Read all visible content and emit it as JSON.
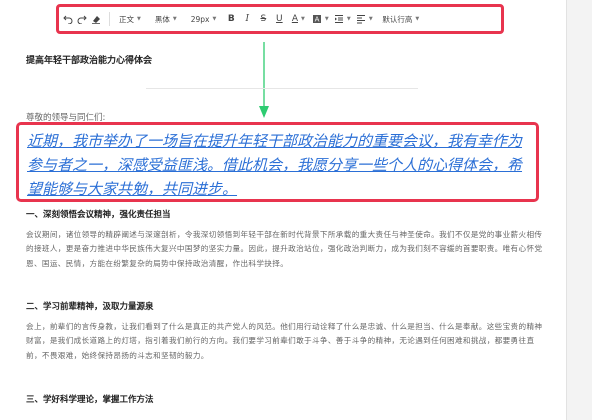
{
  "toolbar": {
    "undo": "undo",
    "redo": "redo",
    "format_painter": "format-painter",
    "paragraph_style": "正文",
    "font_family": "黑体",
    "font_size": "29px",
    "bold": "B",
    "italic": "I",
    "strike": "S",
    "underline": "U",
    "font_color": "A",
    "line_spacing": "默认行高"
  },
  "document": {
    "title": "提高年轻干部政治能力心得体会",
    "greeting": "尊敬的领导与同仁们:",
    "highlighted_paragraph": "近期，我市举办了一场旨在提升年轻干部政治能力的重要会议，我有幸作为参与者之一，深感受益匪浅。借此机会，我愿分享一些个人的心得体会，希望能够与大家共勉，共同进步。",
    "sections": [
      {
        "heading": "一、深刻领悟会议精神，强化责任担当",
        "body": "会议期间，诸位领导的精辟阐述与深邃剖析，令我深切领悟到年轻干部在新时代背景下所承载的重大责任与神圣使命。我们不仅是党的事业薪火相传的接班人，更是奋力推进中华民族伟大复兴中国梦的坚实力量。因此，提升政治站位，强化政治判断力，成为我们刻不容缓的首要职责。唯有心怀党恩、国运、民情，方能在纷繁复杂的局势中保持政治清醒，作出科学抉择。"
      },
      {
        "heading": "二、学习前辈精神，汲取力量源泉",
        "body": "会上，前辈们的言传身教，让我们看到了什么是真正的共产党人的风范。他们用行动诠释了什么是忠诚、什么是担当、什么是奉献。这些宝贵的精神财富，是我们成长道路上的灯塔，指引着我们前行的方向。我们要学习前辈们敢于斗争、善于斗争的精神，无论遇到任何困难和挑战，都要勇往直前，不畏艰难，始终保持昂扬的斗志和坚韧的毅力。"
      },
      {
        "heading": "三、学好科学理论，掌握工作方法",
        "body": ""
      }
    ]
  },
  "colors": {
    "annotation_red": "#e8344e",
    "arrow_green": "#2ecc71",
    "link_blue": "#2b6fd6"
  }
}
